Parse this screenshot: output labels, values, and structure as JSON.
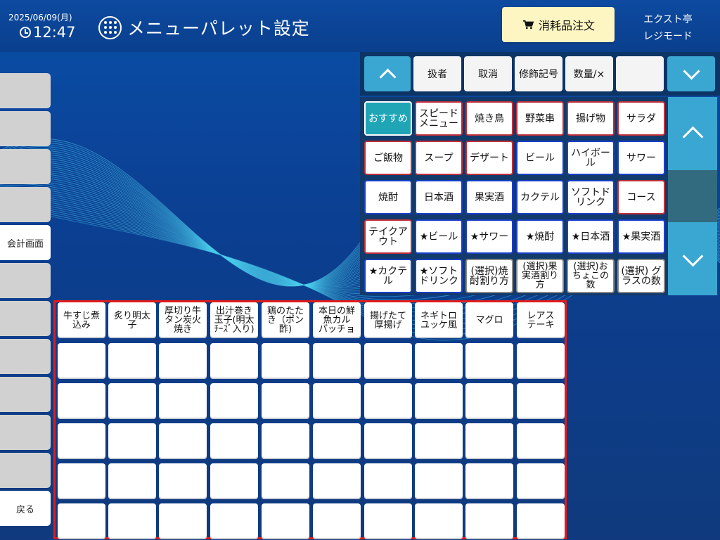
{
  "header": {
    "date": "2025/06/09(月)",
    "time": "12:47",
    "title": "メニューパレット設定",
    "order_button": "消耗品注文",
    "store_name": "エクスト亭",
    "mode": "レジモード"
  },
  "sidebar": {
    "items": [
      "",
      "",
      "",
      "",
      "会計画面",
      "",
      "",
      "",
      "",
      "",
      "",
      "戻る"
    ]
  },
  "function_bar": {
    "buttons": [
      "扱者",
      "取消",
      "修飾記号",
      "数量/×",
      ""
    ]
  },
  "categories": {
    "items": [
      [
        "おすすめ",
        "スピード\nメニュー",
        "焼き鳥",
        "野菜串",
        "揚げ物",
        "サラダ"
      ],
      [
        "ご飯物",
        "スープ",
        "デザート",
        "ビール",
        "ハイボー\nル",
        "サワー"
      ],
      [
        "焼酎",
        "日本酒",
        "果実酒",
        "カクテル",
        "ソフトド\nリンク",
        "コース"
      ],
      [
        "テイクア\nウト",
        "★ビール",
        "★サワー",
        "★焼酎",
        "★日本酒",
        "★果実酒"
      ],
      [
        "★カクテ\nル",
        "★ソフト\nドリンク",
        "(選択)焼\n酎割り方",
        "(選択)果\n実酒割り\n方",
        "(選択)お\nちょこの\n数",
        "(選択) グ\nラスの数"
      ]
    ],
    "selected": "おすすめ"
  },
  "menu_grid": {
    "row1": [
      "牛すじ煮\n込み",
      "炙り明太\n子",
      "厚切り牛\nタン炭火\n焼き",
      "出汁巻き\n玉子(明太\nﾁｰｽﾞ入り)",
      "鶏のたた\nき（ポン\n酢)",
      "本日の鮮\n魚カル\nパッチョ",
      "揚げたて\n厚揚げ",
      "ネギトロ\nユッケ風",
      "マグロ",
      "レアス\nテーキ"
    ]
  },
  "icons": [
    "clock-icon",
    "grid-icon",
    "cart-icon",
    "chevron-up-icon",
    "chevron-down-icon"
  ],
  "colors": {
    "accent": "#3aa7d2",
    "selected": "#1fa5b6",
    "order_button": "#fdf6c3",
    "grid_border": "#e01c1c"
  }
}
